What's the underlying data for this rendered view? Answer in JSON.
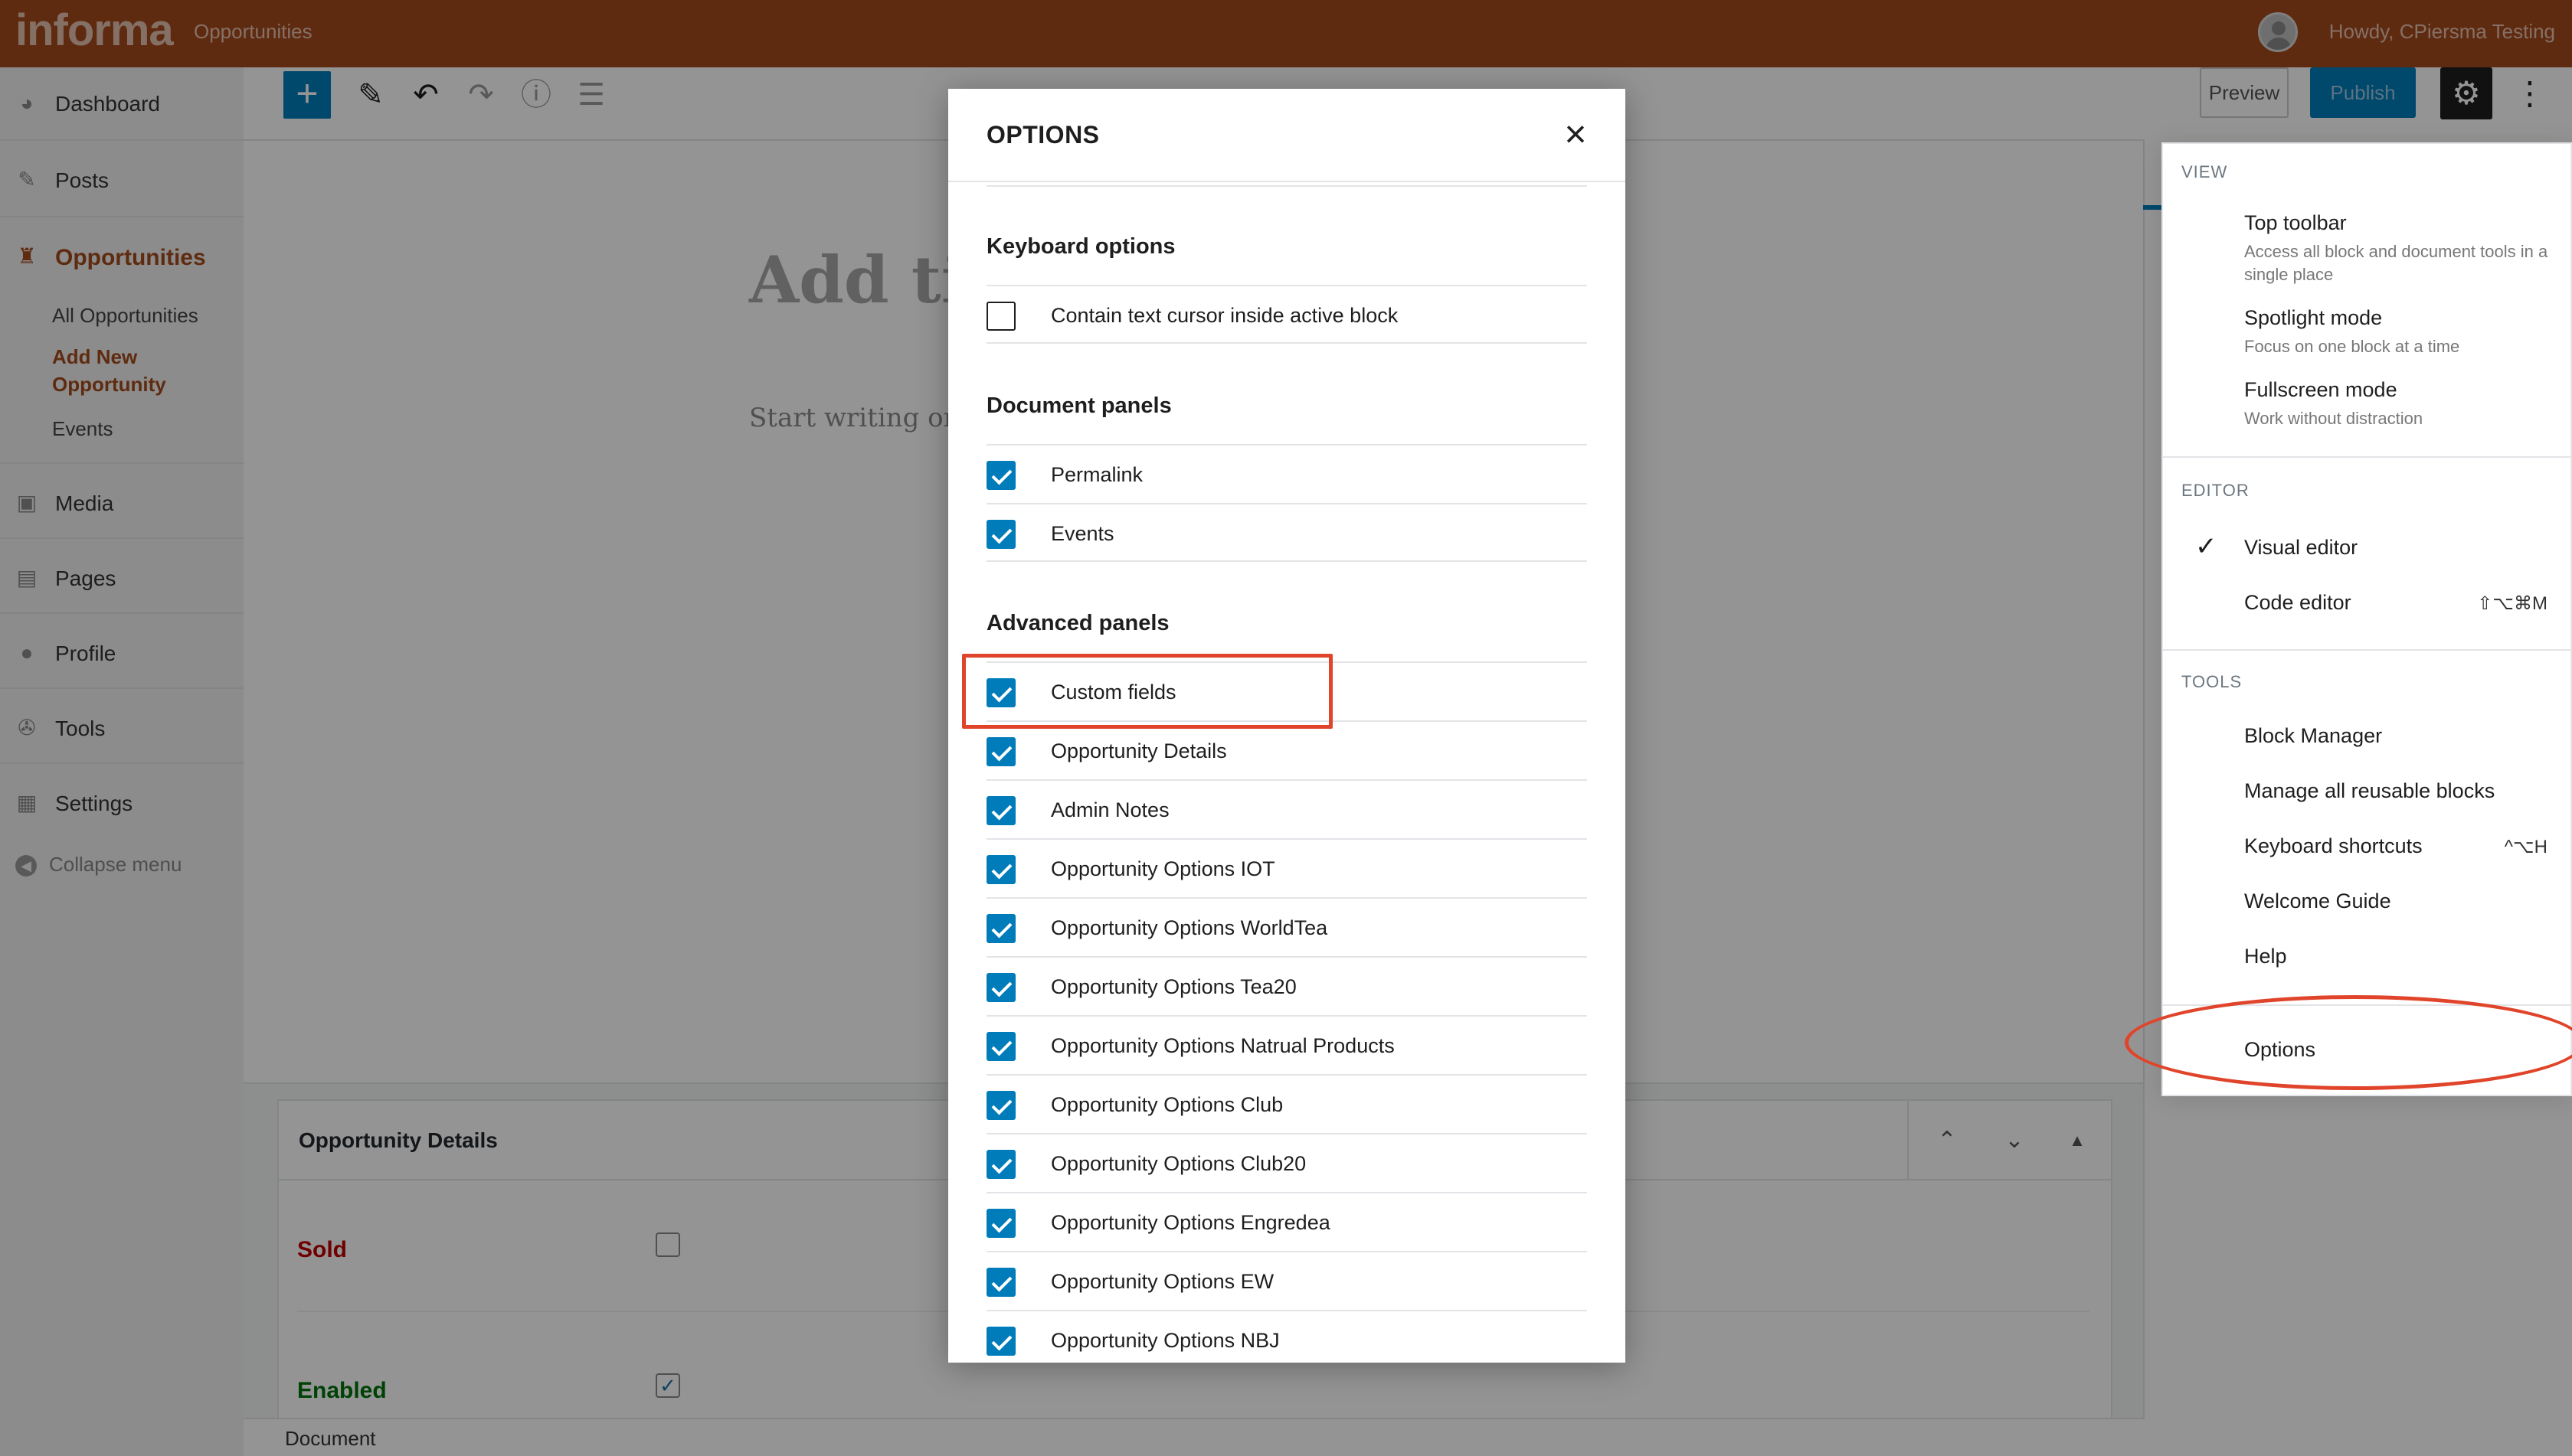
{
  "admin_bar": {
    "brand": "informa",
    "site_link": "Opportunities",
    "greeting": "Howdy, CPiersma Testing"
  },
  "admin_menu": {
    "items": [
      {
        "label": "Dashboard",
        "icon": "dashboard-icon"
      },
      {
        "label": "Posts",
        "icon": "pin-icon"
      },
      {
        "label": "Opportunities",
        "icon": "opportunities-icon"
      },
      {
        "label": "Media",
        "icon": "media-icon"
      },
      {
        "label": "Pages",
        "icon": "pages-icon"
      },
      {
        "label": "Profile",
        "icon": "user-icon"
      },
      {
        "label": "Tools",
        "icon": "wrench-icon"
      },
      {
        "label": "Settings",
        "icon": "settings-icon"
      }
    ],
    "submenu": [
      {
        "label": "All Opportunities"
      },
      {
        "label": "Add New Opportunity"
      },
      {
        "label": "Events"
      }
    ],
    "collapse_label": "Collapse menu"
  },
  "toolbar": {
    "add_symbol": "+",
    "preview_label": "Preview",
    "publish_label": "Publish"
  },
  "editor": {
    "title_placeholder": "Add tit",
    "body_placeholder": "Start writing or t"
  },
  "metabox": {
    "title": "Opportunity Details",
    "fields": [
      {
        "label": "Sold",
        "checked": false,
        "color": "#c00000"
      },
      {
        "label": "Enabled",
        "checked": true,
        "color": "#00730a"
      }
    ]
  },
  "footer": {
    "breadcrumb": "Document"
  },
  "more_menu": {
    "view_title": "VIEW",
    "view_items": [
      {
        "label": "Top toolbar",
        "desc": "Access all block and document tools in a single place"
      },
      {
        "label": "Spotlight mode",
        "desc": "Focus on one block at a time"
      },
      {
        "label": "Fullscreen mode",
        "desc": "Work without distraction"
      }
    ],
    "editor_title": "EDITOR",
    "editor_items": [
      {
        "label": "Visual editor",
        "selected": true,
        "shortcut": ""
      },
      {
        "label": "Code editor",
        "selected": false,
        "shortcut": "⇧⌥⌘M"
      }
    ],
    "tools_title": "TOOLS",
    "tools_items": [
      {
        "label": "Block Manager",
        "shortcut": ""
      },
      {
        "label": "Manage all reusable blocks",
        "shortcut": ""
      },
      {
        "label": "Keyboard shortcuts",
        "shortcut": "^⌥H"
      },
      {
        "label": "Welcome Guide",
        "shortcut": ""
      },
      {
        "label": "Help",
        "shortcut": ""
      }
    ],
    "options_label": "Options"
  },
  "modal": {
    "title": "OPTIONS",
    "sections": [
      {
        "title": "Keyboard options",
        "options": [
          {
            "label": "Contain text cursor inside active block",
            "checked": false
          }
        ]
      },
      {
        "title": "Document panels",
        "options": [
          {
            "label": "Permalink",
            "checked": true
          },
          {
            "label": "Events",
            "checked": true
          }
        ]
      },
      {
        "title": "Advanced panels",
        "options": [
          {
            "label": "Custom fields",
            "checked": true
          },
          {
            "label": "Opportunity Details",
            "checked": true
          },
          {
            "label": "Admin Notes",
            "checked": true
          },
          {
            "label": "Opportunity Options IOT",
            "checked": true
          },
          {
            "label": "Opportunity Options WorldTea",
            "checked": true
          },
          {
            "label": "Opportunity Options Tea20",
            "checked": true
          },
          {
            "label": "Opportunity Options Natrual Products",
            "checked": true
          },
          {
            "label": "Opportunity Options Club",
            "checked": true
          },
          {
            "label": "Opportunity Options Club20",
            "checked": true
          },
          {
            "label": "Opportunity Options Engredea",
            "checked": true
          },
          {
            "label": "Opportunity Options EW",
            "checked": true
          },
          {
            "label": "Opportunity Options NBJ",
            "checked": true
          }
        ]
      }
    ]
  },
  "colors": {
    "admin_bar": "#a44a1c",
    "accent": "#007cba",
    "annotation": "#e0452b",
    "active_menu": "#a44a1c"
  }
}
